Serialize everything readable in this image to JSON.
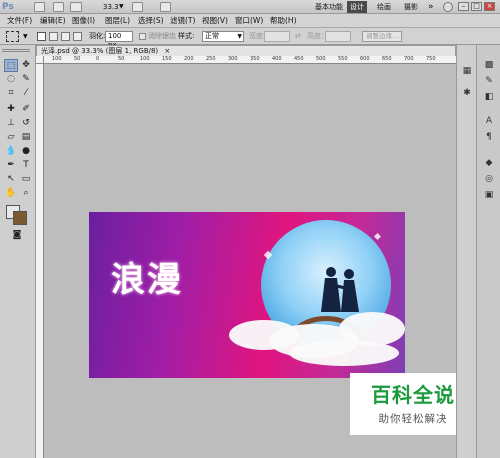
{
  "app": {
    "logo": "Ps",
    "zoom": "33.3",
    "workspaces": [
      "基本功能",
      "设计",
      "绘画",
      "摄影"
    ],
    "active_workspace": "设计",
    "more": "»"
  },
  "menu": [
    "文件(F)",
    "编辑(E)",
    "图像(I)",
    "图层(L)",
    "选择(S)",
    "滤镜(T)",
    "视图(V)",
    "窗口(W)",
    "帮助(H)"
  ],
  "options": {
    "feather_label": "羽化:",
    "feather_value": "100 px",
    "antialias_label": "消除锯齿",
    "style_label": "样式:",
    "style_value": "正常",
    "width_label": "宽度:",
    "height_label": "高度:",
    "refine_edge": "调整边缘..."
  },
  "document": {
    "tab_title": "光泽.psd @ 33.3% (图层 1, RGB/8)",
    "close": "×",
    "ruler_ticks": [
      "100",
      "50",
      "0",
      "50",
      "100",
      "150",
      "200",
      "250",
      "300",
      "350",
      "400",
      "450",
      "500",
      "550",
      "600",
      "650",
      "700",
      "750"
    ],
    "canvas_text": "浪漫"
  },
  "watermark": {
    "title": "百科全说",
    "subtitle": "助你轻松解决"
  }
}
